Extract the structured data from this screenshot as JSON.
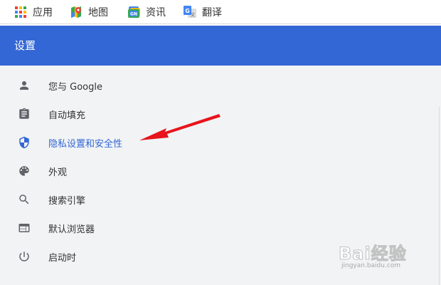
{
  "bookmarks": [
    {
      "label": "应用",
      "icon": "apps-grid-icon"
    },
    {
      "label": "地图",
      "icon": "maps-icon"
    },
    {
      "label": "资讯",
      "icon": "news-icon"
    },
    {
      "label": "翻译",
      "icon": "translate-icon"
    }
  ],
  "header": {
    "title": "设置",
    "color": "#3367d6"
  },
  "menu": {
    "items": [
      {
        "label": "您与 Google",
        "icon": "person-icon"
      },
      {
        "label": "自动填充",
        "icon": "clipboard-icon"
      },
      {
        "label": "隐私设置和安全性",
        "icon": "shield-icon",
        "active": true
      },
      {
        "label": "外观",
        "icon": "palette-icon"
      },
      {
        "label": "搜索引擎",
        "icon": "search-icon"
      },
      {
        "label": "默认浏览器",
        "icon": "browser-icon"
      },
      {
        "label": "启动时",
        "icon": "power-icon"
      }
    ]
  },
  "annotation": {
    "color": "#e8141b",
    "icon": "red-arrow-icon"
  },
  "watermark": {
    "main": "Bai经验",
    "sub": "jingyan.baidu.com"
  }
}
